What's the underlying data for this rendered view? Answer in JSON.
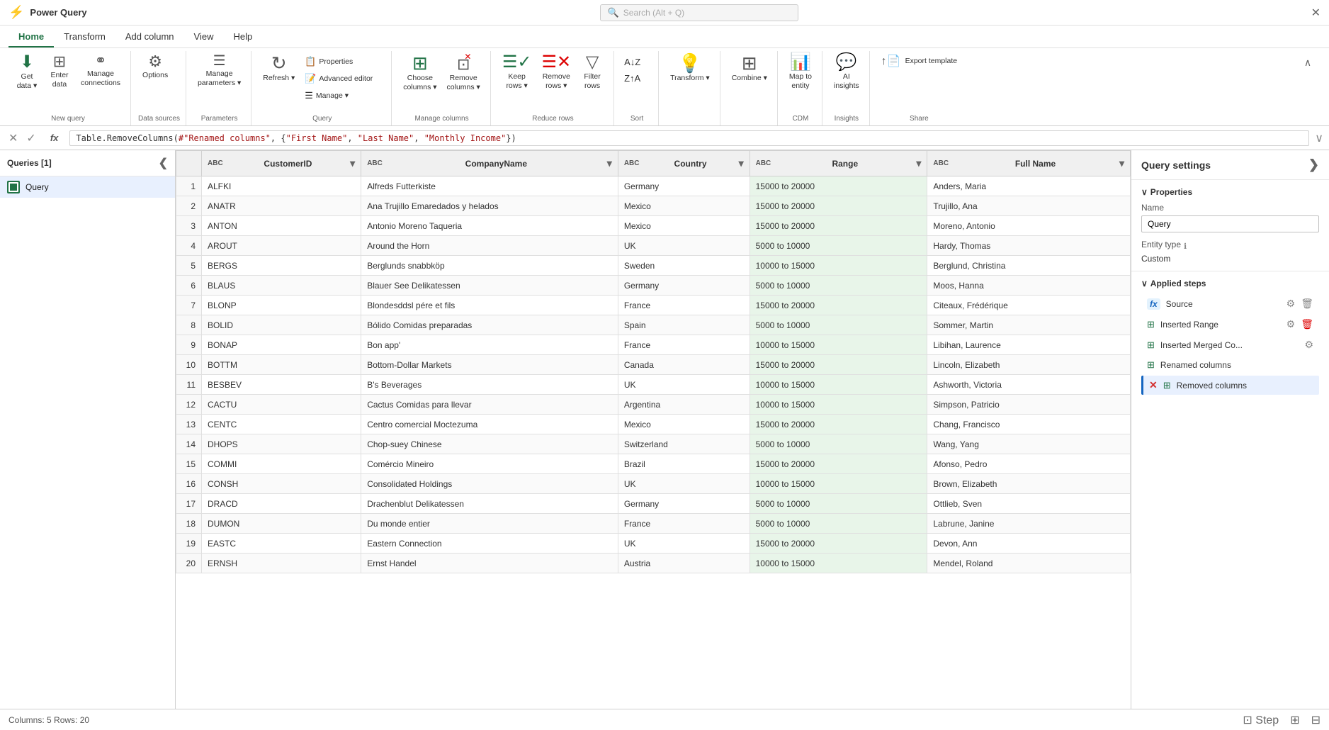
{
  "app": {
    "title": "Power Query",
    "close_btn": "✕"
  },
  "search": {
    "placeholder": "Search (Alt + Q)"
  },
  "menu_tabs": [
    {
      "label": "Home",
      "active": true
    },
    {
      "label": "Transform",
      "active": false
    },
    {
      "label": "Add column",
      "active": false
    },
    {
      "label": "View",
      "active": false
    },
    {
      "label": "Help",
      "active": false
    }
  ],
  "ribbon": {
    "groups": [
      {
        "label": "New query",
        "items": [
          {
            "id": "get-data",
            "icon": "⬇",
            "label": "Get\ndata",
            "has_arrow": true
          },
          {
            "id": "enter-data",
            "icon": "⊞",
            "label": "Enter\ndata",
            "has_arrow": false
          },
          {
            "id": "manage-connections",
            "icon": "🔗",
            "label": "Manage\nconnections",
            "has_arrow": false
          }
        ]
      },
      {
        "label": "Data sources",
        "items": [
          {
            "id": "options",
            "icon": "⚙",
            "label": "Options",
            "has_arrow": false
          }
        ]
      },
      {
        "label": "Parameters",
        "items": [
          {
            "id": "manage-parameters",
            "icon": "≡",
            "label": "Manage\nparameters",
            "has_arrow": true
          }
        ]
      },
      {
        "label": "Query",
        "items": [
          {
            "id": "refresh",
            "icon": "↻",
            "label": "Refresh",
            "has_arrow": true
          },
          {
            "id": "properties",
            "icon": "📋",
            "label": "Properties",
            "has_arrow": false
          },
          {
            "id": "advanced-editor",
            "icon": "📝",
            "label": "Advanced editor",
            "has_arrow": false
          },
          {
            "id": "manage",
            "icon": "≡",
            "label": "Manage",
            "has_arrow": true
          }
        ]
      },
      {
        "label": "Manage columns",
        "items": [
          {
            "id": "choose-columns",
            "icon": "▦",
            "label": "Choose\ncolumns",
            "has_arrow": true
          },
          {
            "id": "remove-columns",
            "icon": "✕▦",
            "label": "Remove\ncolumns",
            "has_arrow": true
          }
        ]
      },
      {
        "label": "Reduce rows",
        "items": [
          {
            "id": "keep-rows",
            "icon": "✓≡",
            "label": "Keep\nrows",
            "has_arrow": true
          },
          {
            "id": "remove-rows",
            "icon": "✕≡",
            "label": "Remove\nrows",
            "has_arrow": true
          },
          {
            "id": "filter-rows",
            "icon": "▽",
            "label": "Filter\nrows",
            "has_arrow": true
          }
        ]
      },
      {
        "label": "Sort",
        "items": [
          {
            "id": "sort-az",
            "icon": "↕",
            "label": "A↓Z",
            "has_arrow": false
          },
          {
            "id": "sort-za",
            "icon": "↕",
            "label": "Z↑A",
            "has_arrow": false
          }
        ]
      },
      {
        "label": "",
        "items": [
          {
            "id": "transform",
            "icon": "💡",
            "label": "Transform",
            "has_arrow": true
          }
        ]
      },
      {
        "label": "",
        "items": [
          {
            "id": "combine",
            "icon": "⊞",
            "label": "Combine",
            "has_arrow": true
          }
        ]
      },
      {
        "label": "CDM",
        "items": [
          {
            "id": "map-to-entity",
            "icon": "📊",
            "label": "Map to\nentity",
            "has_arrow": false
          }
        ]
      },
      {
        "label": "Insights",
        "items": [
          {
            "id": "ai-insights",
            "icon": "💬",
            "label": "AI\ninsights",
            "has_arrow": false
          }
        ]
      },
      {
        "label": "Share",
        "items": [
          {
            "id": "export-template",
            "icon": "↑",
            "label": "Export template",
            "has_arrow": false
          }
        ]
      }
    ]
  },
  "formula_bar": {
    "cancel_label": "✕",
    "confirm_label": "✓",
    "fx_label": "fx",
    "formula": "Table.RemoveColumns(#\"Renamed columns\", {\"First Name\", \"Last Name\", \"Monthly Income\"})",
    "expand_label": "∨"
  },
  "queries_panel": {
    "title": "Queries [1]",
    "collapse_btn": "❮",
    "items": [
      {
        "id": "query",
        "name": "Query",
        "icon_color": "#217346"
      }
    ]
  },
  "table": {
    "columns": [
      {
        "id": "customerid",
        "type": "ABC",
        "label": "CustomerID",
        "highlighted": false
      },
      {
        "id": "companyname",
        "type": "ABC",
        "label": "CompanyName",
        "highlighted": false
      },
      {
        "id": "country",
        "type": "ABC",
        "label": "Country",
        "highlighted": false
      },
      {
        "id": "range",
        "type": "ABC",
        "label": "Range",
        "highlighted": true
      },
      {
        "id": "fullname",
        "type": "ABC",
        "label": "Full Name",
        "highlighted": false
      }
    ],
    "rows": [
      {
        "num": 1,
        "customerid": "ALFKI",
        "companyname": "Alfreds Futterkiste",
        "country": "Germany",
        "range": "15000 to 20000",
        "fullname": "Anders, Maria"
      },
      {
        "num": 2,
        "customerid": "ANATR",
        "companyname": "Ana Trujillo Emaredados y helados",
        "country": "Mexico",
        "range": "15000 to 20000",
        "fullname": "Trujillo, Ana"
      },
      {
        "num": 3,
        "customerid": "ANTON",
        "companyname": "Antonio Moreno Taqueria",
        "country": "Mexico",
        "range": "15000 to 20000",
        "fullname": "Moreno, Antonio"
      },
      {
        "num": 4,
        "customerid": "AROUT",
        "companyname": "Around the Horn",
        "country": "UK",
        "range": "5000 to 10000",
        "fullname": "Hardy, Thomas"
      },
      {
        "num": 5,
        "customerid": "BERGS",
        "companyname": "Berglunds snabbköp",
        "country": "Sweden",
        "range": "10000 to 15000",
        "fullname": "Berglund, Christina"
      },
      {
        "num": 6,
        "customerid": "BLAUS",
        "companyname": "Blauer See Delikatessen",
        "country": "Germany",
        "range": "5000 to 10000",
        "fullname": "Moos, Hanna"
      },
      {
        "num": 7,
        "customerid": "BLONP",
        "companyname": "Blondesddsl pére et fils",
        "country": "France",
        "range": "15000 to 20000",
        "fullname": "Citeaux, Frédérique"
      },
      {
        "num": 8,
        "customerid": "BOLID",
        "companyname": "Bólido Comidas preparadas",
        "country": "Spain",
        "range": "5000 to 10000",
        "fullname": "Sommer, Martin"
      },
      {
        "num": 9,
        "customerid": "BONAP",
        "companyname": "Bon app'",
        "country": "France",
        "range": "10000 to 15000",
        "fullname": "Libihan, Laurence"
      },
      {
        "num": 10,
        "customerid": "BOTTM",
        "companyname": "Bottom-Dollar Markets",
        "country": "Canada",
        "range": "15000 to 20000",
        "fullname": "Lincoln, Elizabeth"
      },
      {
        "num": 11,
        "customerid": "BESBEV",
        "companyname": "B's Beverages",
        "country": "UK",
        "range": "10000 to 15000",
        "fullname": "Ashworth, Victoria"
      },
      {
        "num": 12,
        "customerid": "CACTU",
        "companyname": "Cactus Comidas para llevar",
        "country": "Argentina",
        "range": "10000 to 15000",
        "fullname": "Simpson, Patricio"
      },
      {
        "num": 13,
        "customerid": "CENTC",
        "companyname": "Centro comercial Moctezuma",
        "country": "Mexico",
        "range": "15000 to 20000",
        "fullname": "Chang, Francisco"
      },
      {
        "num": 14,
        "customerid": "DHOPS",
        "companyname": "Chop-suey Chinese",
        "country": "Switzerland",
        "range": "5000 to 10000",
        "fullname": "Wang, Yang"
      },
      {
        "num": 15,
        "customerid": "COMMI",
        "companyname": "Comércio Mineiro",
        "country": "Brazil",
        "range": "15000 to 20000",
        "fullname": "Afonso, Pedro"
      },
      {
        "num": 16,
        "customerid": "CONSH",
        "companyname": "Consolidated Holdings",
        "country": "UK",
        "range": "10000 to 15000",
        "fullname": "Brown, Elizabeth"
      },
      {
        "num": 17,
        "customerid": "DRACD",
        "companyname": "Drachenblut Delikatessen",
        "country": "Germany",
        "range": "5000 to 10000",
        "fullname": "Ottlieb, Sven"
      },
      {
        "num": 18,
        "customerid": "DUMON",
        "companyname": "Du monde entier",
        "country": "France",
        "range": "5000 to 10000",
        "fullname": "Labrune, Janine"
      },
      {
        "num": 19,
        "customerid": "EASTC",
        "companyname": "Eastern Connection",
        "country": "UK",
        "range": "15000 to 20000",
        "fullname": "Devon, Ann"
      },
      {
        "num": 20,
        "customerid": "ERNSH",
        "companyname": "Ernst Handel",
        "country": "Austria",
        "range": "10000 to 15000",
        "fullname": "Mendel, Roland"
      }
    ]
  },
  "query_settings": {
    "title": "Query settings",
    "expand_btn": "❯",
    "properties_label": "Properties",
    "properties_chevron": "∨",
    "name_label": "Name",
    "name_value": "Query",
    "entity_type_label": "Entity type",
    "entity_type_info": "ℹ",
    "entity_type_value": "Custom",
    "applied_steps_label": "Applied steps",
    "applied_steps_chevron": "∨",
    "steps": [
      {
        "id": "source",
        "icon": "fx",
        "icon_type": "fx",
        "label": "Source",
        "has_gear": true,
        "has_delete": true,
        "active": false,
        "error": false
      },
      {
        "id": "inserted-range",
        "icon": "⊞",
        "icon_type": "table",
        "label": "Inserted Range",
        "has_gear": true,
        "has_delete": true,
        "active": false,
        "error": false
      },
      {
        "id": "inserted-merged",
        "icon": "⊞",
        "icon_type": "table",
        "label": "Inserted Merged Co...",
        "has_gear": true,
        "has_delete": false,
        "active": false,
        "error": false
      },
      {
        "id": "renamed-columns",
        "icon": "⊞",
        "icon_type": "table",
        "label": "Renamed columns",
        "has_gear": false,
        "has_delete": false,
        "active": false,
        "error": false
      },
      {
        "id": "removed-columns",
        "icon": "⊞",
        "icon_type": "table-x",
        "label": "Removed columns",
        "has_gear": false,
        "has_delete": false,
        "active": true,
        "error": true
      }
    ]
  },
  "status_bar": {
    "info": "Columns: 5  Rows: 20",
    "step_label": "Step",
    "icons": [
      "step-icon",
      "columns-icon",
      "grid-icon"
    ]
  }
}
